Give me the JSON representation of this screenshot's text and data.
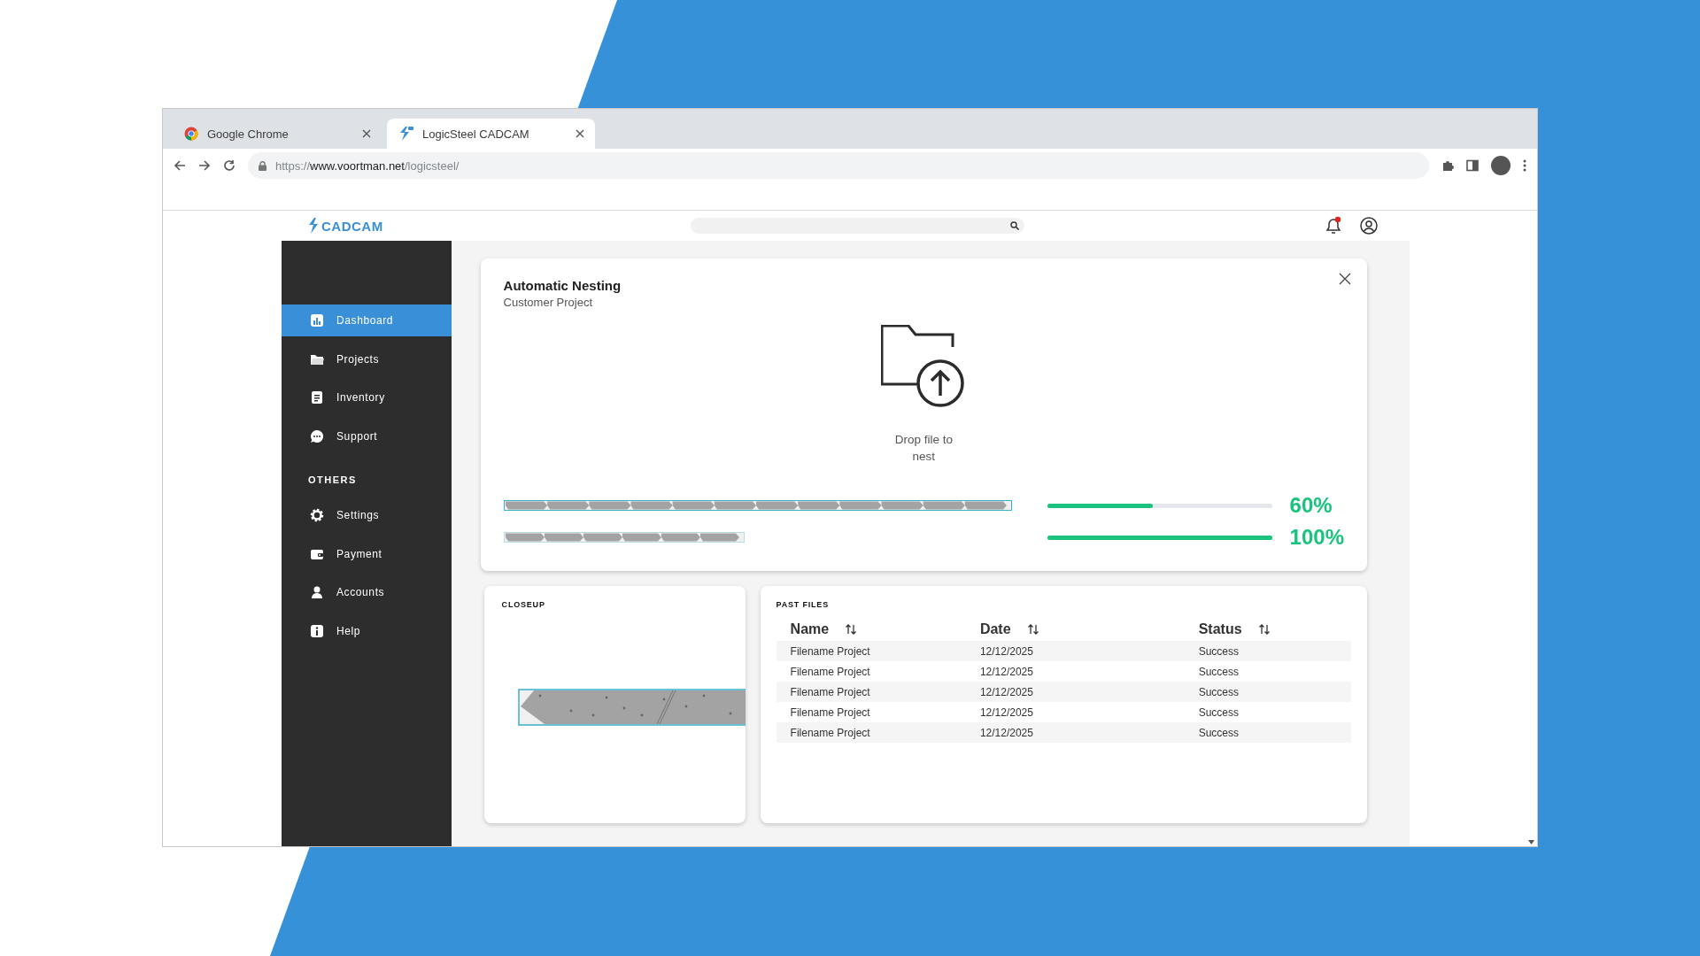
{
  "browser": {
    "tabs": [
      {
        "title": "Google Chrome",
        "selected": false
      },
      {
        "title": "LogicSteel CADCAM",
        "selected": true
      }
    ],
    "address": {
      "scheme": "https://",
      "host": "www.voortman.net",
      "path": "/logicsteel/"
    }
  },
  "app": {
    "logo": "CADCAM",
    "notifications": {
      "unread": true
    }
  },
  "sidebar": {
    "items": [
      {
        "label": "Dashboard",
        "selected": true
      },
      {
        "label": "Projects",
        "selected": false
      },
      {
        "label": "Inventory",
        "selected": false
      },
      {
        "label": "Support",
        "selected": false
      }
    ],
    "section": "OTHERS",
    "other_items": [
      {
        "label": "Settings",
        "selected": false
      },
      {
        "label": "Payment",
        "selected": false
      },
      {
        "label": "Accounts",
        "selected": false
      },
      {
        "label": "Help",
        "selected": false
      }
    ]
  },
  "nesting": {
    "title": "Automatic Nesting",
    "subtitle": "Customer Project",
    "drop_text": "Drop file to nest",
    "jobs": [
      {
        "level": 0.47,
        "reading": "60%"
      },
      {
        "level": 1,
        "reading": "100%"
      }
    ]
  },
  "closeup": {
    "title": "CLOSEUP"
  },
  "past_files": {
    "title": "PAST FILES",
    "columns": [
      "Name",
      "Date",
      "Status"
    ],
    "rows": [
      [
        "Filename Project",
        "12/12/2025",
        "Success"
      ],
      [
        "Filename Project",
        "12/12/2025",
        "Success"
      ],
      [
        "Filename Project",
        "12/12/2025",
        "Success"
      ],
      [
        "Filename Project",
        "12/12/2025",
        "Success"
      ],
      [
        "Filename Project",
        "12/12/2025",
        "Success"
      ]
    ]
  }
}
